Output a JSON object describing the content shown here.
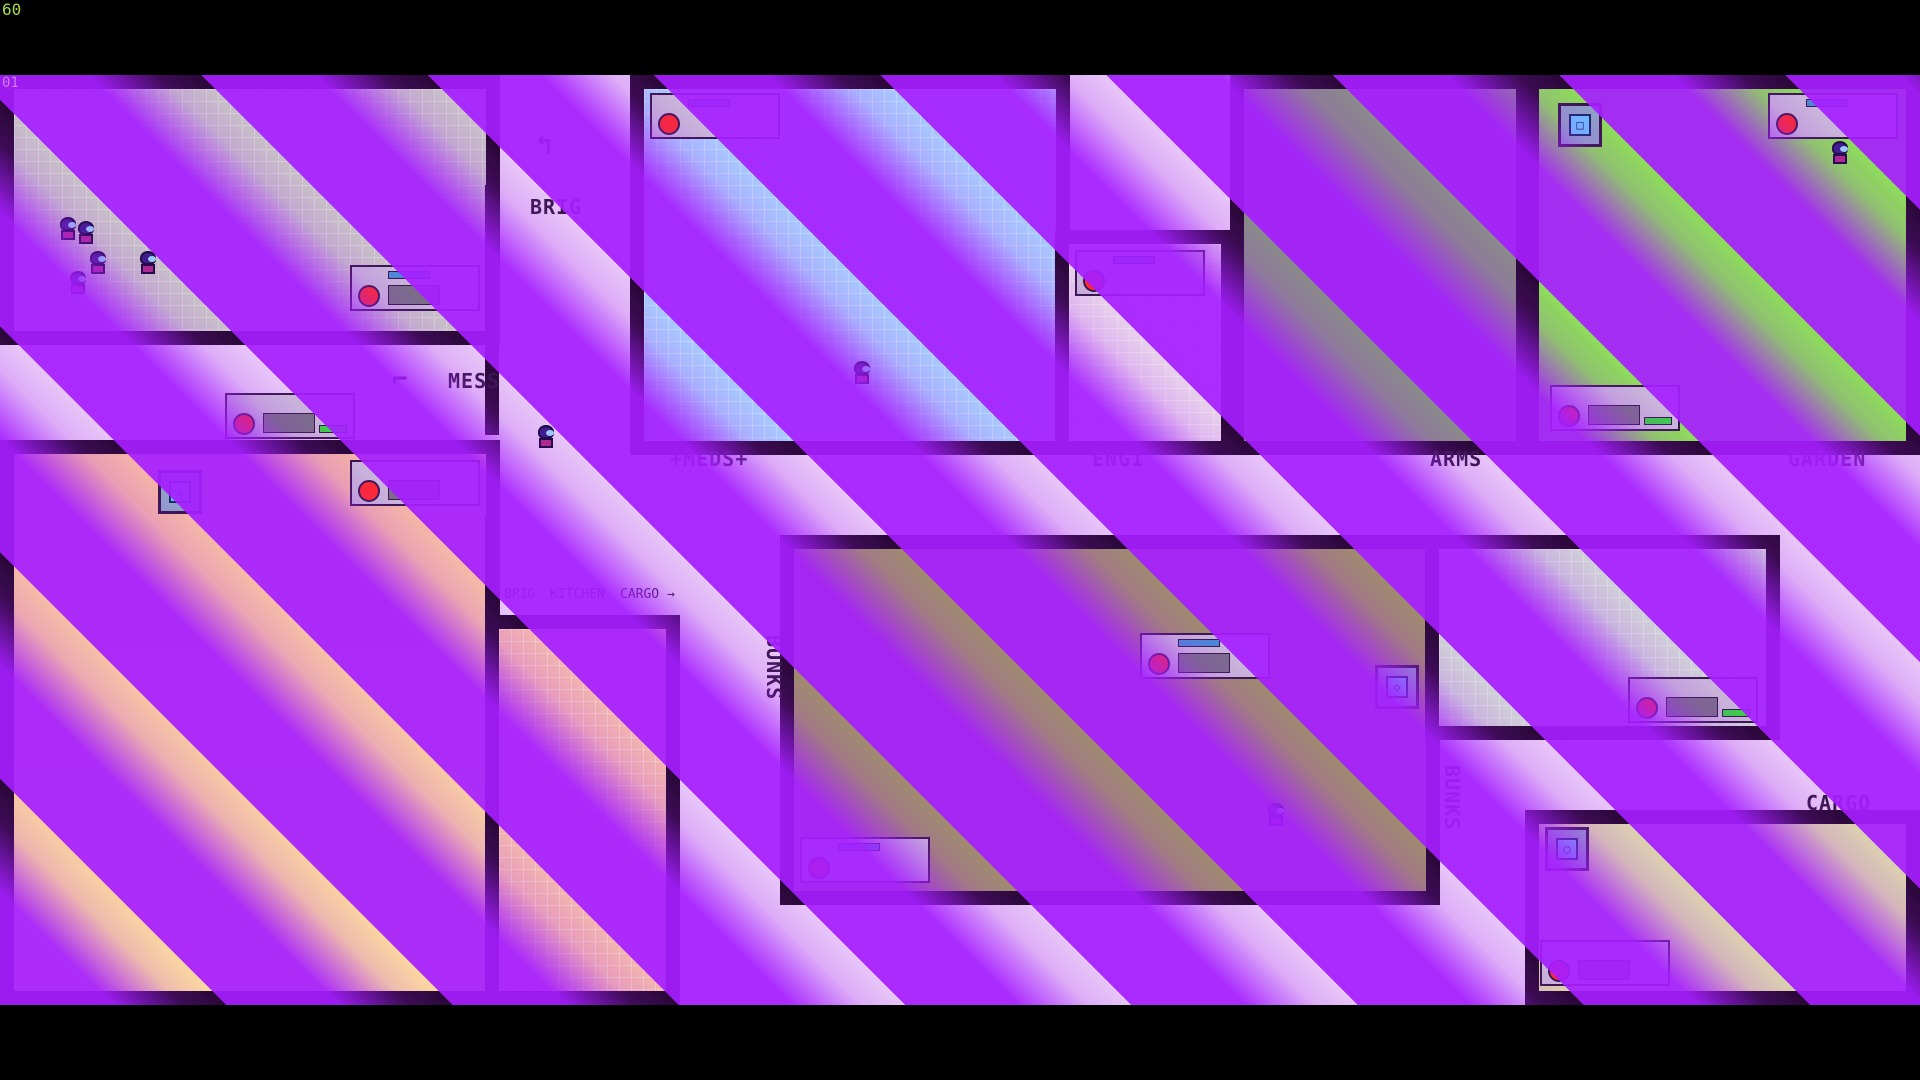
{
  "hud": {
    "fps": "60",
    "corner_tag": "01"
  },
  "rooms": {
    "brig_label": "BRIG",
    "mess_label": "MESS",
    "meds_label": "+MEDS+",
    "eng_label": "ENG1",
    "arms_label": "ARMS",
    "garden_label": "GARDEN",
    "bunks_label_left": "BUNKS",
    "bunks_label_right": "BUNKS",
    "cargo_label": "CARGO"
  },
  "signpost": {
    "brig": "BRIG",
    "kitchen": "KITCHEN",
    "cargo": "CARGO →"
  },
  "colors": {
    "stripe": "#a61eff",
    "wall": "#2a0838",
    "corridor": "#e7c6f7"
  }
}
